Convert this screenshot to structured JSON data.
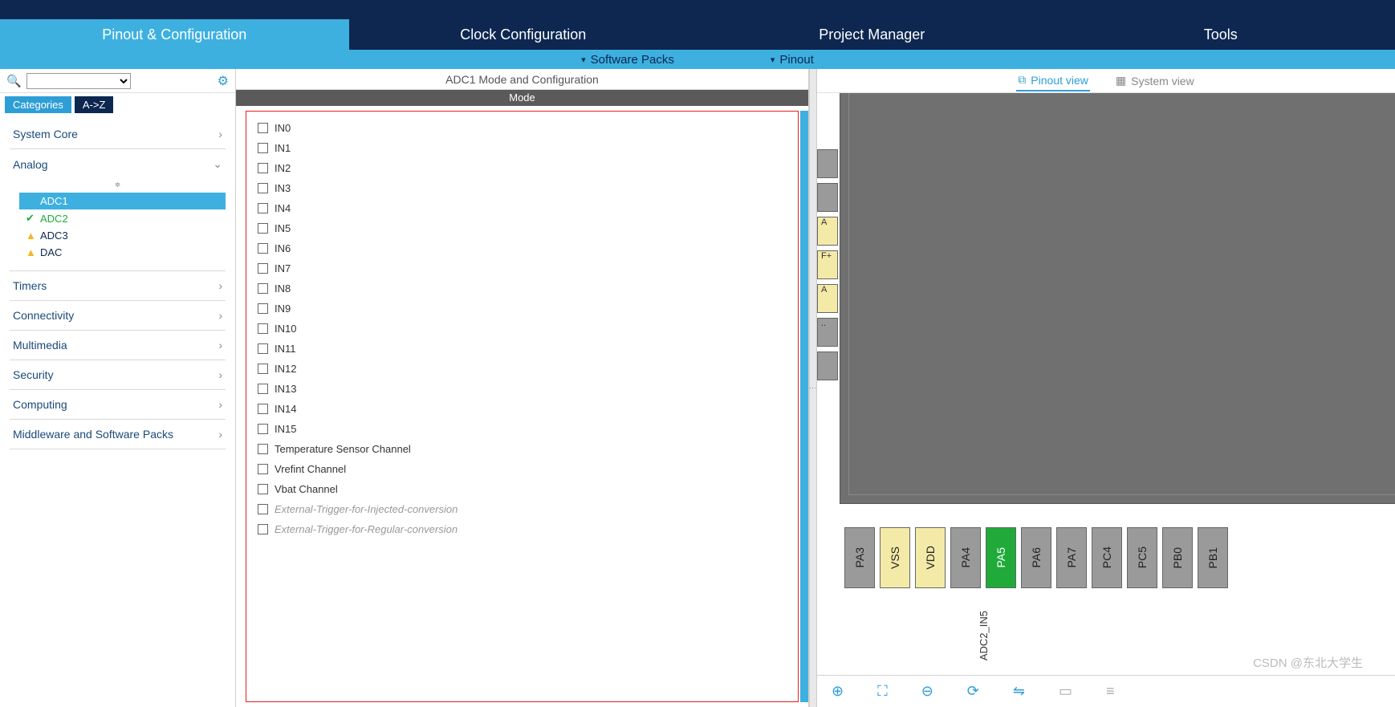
{
  "main_tabs": {
    "pinout": "Pinout & Configuration",
    "clock": "Clock Configuration",
    "project": "Project Manager",
    "tools": "Tools"
  },
  "sub_tabs": {
    "software_packs": "Software Packs",
    "pinout": "Pinout"
  },
  "left": {
    "tab_categories": "Categories",
    "tab_az": "A->Z",
    "groups": {
      "system_core": "System Core",
      "analog": "Analog",
      "timers": "Timers",
      "connectivity": "Connectivity",
      "multimedia": "Multimedia",
      "security": "Security",
      "computing": "Computing",
      "middleware": "Middleware and Software Packs"
    },
    "analog_items": {
      "adc1": "ADC1",
      "adc2": "ADC2",
      "adc3": "ADC3",
      "dac": "DAC"
    }
  },
  "center": {
    "title": "ADC1 Mode and Configuration",
    "mode_header": "Mode",
    "items": {
      "in0": "IN0",
      "in1": "IN1",
      "in2": "IN2",
      "in3": "IN3",
      "in4": "IN4",
      "in5": "IN5",
      "in6": "IN6",
      "in7": "IN7",
      "in8": "IN8",
      "in9": "IN9",
      "in10": "IN10",
      "in11": "IN11",
      "in12": "IN12",
      "in13": "IN13",
      "in14": "IN14",
      "in15": "IN15",
      "temp": "Temperature Sensor Channel",
      "vref": "Vrefint Channel",
      "vbat": "Vbat Channel",
      "ext_inj": "External-Trigger-for-Injected-conversion",
      "ext_reg": "External-Trigger-for-Regular-conversion"
    }
  },
  "right": {
    "pinout_view": "Pinout view",
    "system_view": "System view",
    "left_pin_labels": {
      "a1": "A",
      "fplus": "F+",
      "a2": "A",
      "dots": ".."
    },
    "bottom_pins": {
      "pa3": "PA3",
      "vss": "VSS",
      "vdd": "VDD",
      "pa4": "PA4",
      "pa5": "PA5",
      "pa6": "PA6",
      "pa7": "PA7",
      "pc4": "PC4",
      "pc5": "PC5",
      "pb0": "PB0",
      "pb1": "PB1"
    },
    "annotation": "ADC2_IN5"
  },
  "watermark": "CSDN @东北大学生"
}
